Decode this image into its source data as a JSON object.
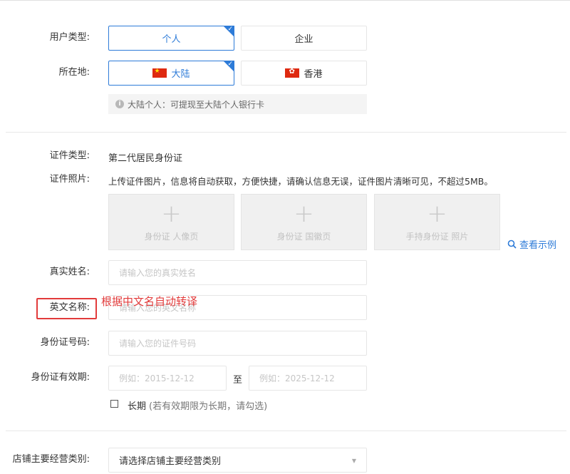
{
  "user_type": {
    "label": "用户类型:",
    "options": [
      "个人",
      "企业"
    ],
    "selected": "个人"
  },
  "location": {
    "label": "所在地:",
    "options": [
      "大陆",
      "香港"
    ],
    "selected": "大陆"
  },
  "location_note": "大陆个人：可提现至大陆个人银行卡",
  "id_type": {
    "label": "证件类型:",
    "value": "第二代居民身份证"
  },
  "id_photo": {
    "label": "证件照片:",
    "hint": "上传证件图片，信息将自动获取，方便快捷，请确认信息无误，证件图片清晰可见，不超过5MB。",
    "slots": [
      "身份证 人像页",
      "身份证 国徽页",
      "手持身份证 照片"
    ],
    "example_link": "查看示例"
  },
  "real_name": {
    "label": "真实姓名:",
    "placeholder": "请输入您的真实姓名"
  },
  "english_name": {
    "label": "英文名称:",
    "placeholder": "请输入您的英文名称",
    "annotation": "根据中文名自动转译"
  },
  "id_number": {
    "label": "身份证号码:",
    "placeholder": "请输入您的证件号码"
  },
  "id_validity": {
    "label": "身份证有效期:",
    "start_placeholder": "例如：2015-12-12",
    "separator": "至",
    "end_placeholder": "例如：2025-12-12",
    "long_term_label": "长期",
    "long_term_hint": "(若有效期限为长期，请勾选)",
    "long_term_checked": false
  },
  "store_category": {
    "label": "店铺主要经营类别:",
    "placeholder": "请选择店铺主要经营类别"
  },
  "colors": {
    "accent": "#2d7bd8",
    "annotation": "#e23b3b"
  },
  "icons": [
    "check-icon",
    "china-flag-icon",
    "hong-kong-flag-icon",
    "info-icon",
    "plus-icon",
    "search-icon",
    "caret-down-icon"
  ]
}
